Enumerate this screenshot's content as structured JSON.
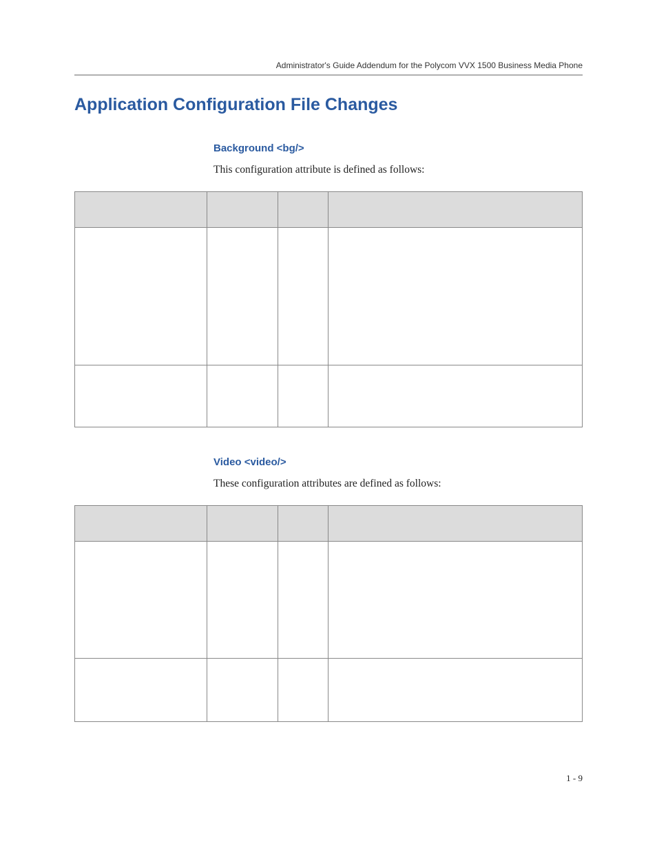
{
  "header": {
    "running_title": "Administrator's Guide Addendum for the Polycom VVX 1500 Business Media Phone"
  },
  "section": {
    "title": "Application Configuration File Changes"
  },
  "subsection1": {
    "heading": "Background <bg/>",
    "intro": "This configuration attribute is defined as follows:"
  },
  "table1_headers": {
    "c0": "",
    "c1": "",
    "c2": "",
    "c3": ""
  },
  "subsection2": {
    "heading": "Video <video/>",
    "intro": "These configuration attributes are defined as follows:"
  },
  "table2_headers": {
    "c0": "",
    "c1": "",
    "c2": "",
    "c3": ""
  },
  "footer": {
    "page_number": "1 - 9"
  }
}
